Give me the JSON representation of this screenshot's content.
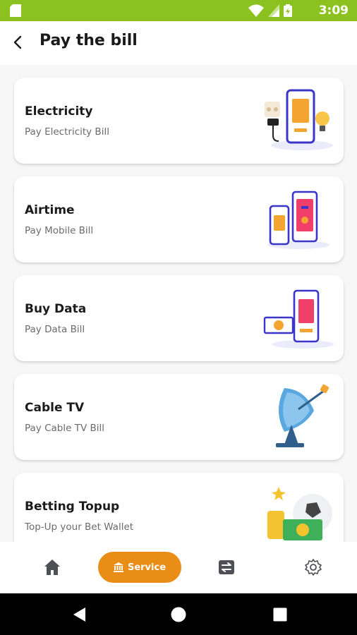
{
  "status_bar": {
    "time": "3:09",
    "icons": [
      "sim-card-icon",
      "wifi-icon",
      "cell-signal-icon",
      "battery-icon"
    ]
  },
  "header": {
    "title": "Pay the bill"
  },
  "services": [
    {
      "title": "Electricity",
      "subtitle": "Pay Electricity Bill",
      "icon": "electricity-illustration"
    },
    {
      "title": "Airtime",
      "subtitle": "Pay Mobile Bill",
      "icon": "airtime-illustration"
    },
    {
      "title": "Buy Data",
      "subtitle": "Pay Data Bill",
      "icon": "data-illustration"
    },
    {
      "title": "Cable TV",
      "subtitle": "Pay Cable TV Bill",
      "icon": "satellite-dish-illustration"
    },
    {
      "title": "Betting Topup",
      "subtitle": "Top-Up your Bet Wallet",
      "icon": "betting-illustration"
    }
  ],
  "bottom_nav": {
    "items": [
      {
        "label": "",
        "icon": "home-icon"
      },
      {
        "label": "Service",
        "icon": "bank-icon",
        "active": true
      },
      {
        "label": "",
        "icon": "transfer-icon"
      },
      {
        "label": "",
        "icon": "settings-gear-icon"
      }
    ]
  },
  "colors": {
    "status_bar": "#8cc21f",
    "accent": "#e98d17",
    "illustration_primary": "#3b35c9",
    "illustration_secondary": "#f4a531",
    "illustration_pink": "#f0406a"
  }
}
